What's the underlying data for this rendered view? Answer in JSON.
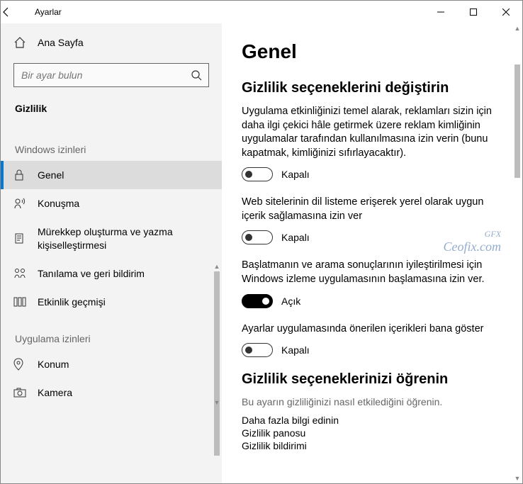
{
  "window_title": "Ayarlar",
  "sidebar": {
    "home": "Ana Sayfa",
    "search_placeholder": "Bir ayar bulun",
    "category": "Gizlilik",
    "groups": [
      {
        "label": "Windows izinleri",
        "items": [
          {
            "icon": "lock-icon",
            "label": "Genel",
            "selected": true
          },
          {
            "icon": "speech-icon",
            "label": "Konuşma",
            "selected": false
          },
          {
            "icon": "ink-icon",
            "label": "Mürekkep oluşturma ve yazma kişiselleştirmesi",
            "selected": false
          },
          {
            "icon": "feedback-icon",
            "label": "Tanılama ve geri bildirim",
            "selected": false
          },
          {
            "icon": "activity-icon",
            "label": "Etkinlik geçmişi",
            "selected": false
          }
        ]
      },
      {
        "label": "Uygulama izinleri",
        "items": [
          {
            "icon": "location-icon",
            "label": "Konum",
            "selected": false
          },
          {
            "icon": "camera-icon",
            "label": "Kamera",
            "selected": false
          }
        ]
      }
    ]
  },
  "main": {
    "title": "Genel",
    "section1_heading": "Gizlilik seçeneklerini değiştirin",
    "settings": [
      {
        "desc": "Uygulama etkinliğinizi temel alarak, reklamları sizin için daha ilgi çekici hâle getirmek üzere reklam kimliğinin uygulamalar tarafından kullanılmasına izin verin (bunu kapatmak, kimliğinizi sıfırlayacaktır).",
        "state_label": "Kapalı",
        "on": false
      },
      {
        "desc": "Web sitelerinin dil listeme erişerek yerel olarak uygun içerik sağlamasına izin ver",
        "state_label": "Kapalı",
        "on": false
      },
      {
        "desc": "Başlatmanın ve arama sonuçlarının iyileştirilmesi için Windows izleme uygulamasının başlamasına izin ver.",
        "state_label": "Açık",
        "on": true
      },
      {
        "desc": "Ayarlar uygulamasında önerilen içerikleri bana göster",
        "state_label": "Kapalı",
        "on": false
      }
    ],
    "section2_heading": "Gizlilik seçeneklerinizi öğrenin",
    "section2_sub": "Bu ayarın gizliliğinizi nasıl etkilediğini öğrenin.",
    "links": [
      "Daha fazla bilgi edinin",
      "Gizlilik panosu",
      "Gizlilik bildirimi"
    ]
  },
  "watermark": {
    "top": "GFX",
    "text": "Ceofix.com"
  }
}
